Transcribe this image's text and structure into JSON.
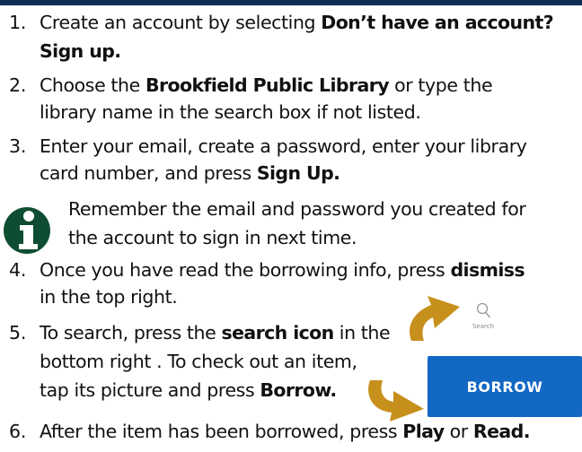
{
  "steps": [
    {
      "number": "1.",
      "lines": [
        [
          {
            "t": "Create an account by selecting "
          },
          {
            "t": "Don’t have an account?",
            "b": true
          }
        ],
        [
          {
            "t": "Sign up.",
            "b": true
          }
        ]
      ]
    },
    {
      "number": "2.",
      "lines": [
        [
          {
            "t": "Choose the "
          },
          {
            "t": "Brookfield Public Library",
            "b": true
          },
          {
            "t": " or type the"
          }
        ],
        [
          {
            "t": "library name in the search box if not listed."
          }
        ]
      ]
    },
    {
      "number": "3.",
      "lines": [
        [
          {
            "t": "Enter your email, create a password, enter your library"
          }
        ],
        [
          {
            "t": "card number, and press "
          },
          {
            "t": "Sign Up.",
            "b": true
          }
        ]
      ]
    },
    {
      "number": "",
      "lines": [
        [
          {
            "t": "Remember the email and password you created for"
          }
        ],
        [
          {
            "t": "the account to sign in next time."
          }
        ]
      ]
    },
    {
      "number": "4.",
      "lines": [
        [
          {
            "t": "Once you have read the borrowing info, press "
          },
          {
            "t": "dismiss",
            "b": true
          }
        ],
        [
          {
            "t": "in the top right."
          }
        ]
      ]
    },
    {
      "number": "5.",
      "lines": [
        [
          {
            "t": "To search, press the "
          },
          {
            "t": "search icon",
            "b": true
          },
          {
            "t": " in the"
          }
        ],
        [
          {
            "t": "bottom right . To check out an item,"
          }
        ],
        [
          {
            "t": "tap its picture and press "
          },
          {
            "t": "Borrow.",
            "b": true
          }
        ]
      ]
    },
    {
      "number": "6.",
      "lines": [
        [
          {
            "t": "After the item has been borrowed, press "
          },
          {
            "t": "Play",
            "b": true
          },
          {
            "t": " or "
          },
          {
            "t": "Read.",
            "b": true
          }
        ]
      ]
    }
  ],
  "search_widget": {
    "icon": "magnifier-icon",
    "caption": "Search"
  },
  "borrow_button": {
    "label": "BORROW"
  },
  "colors": {
    "header_bar": "#0d2d52",
    "info_icon": "#0f4d32",
    "arrow": "#c7901c",
    "button": "#1368c4"
  }
}
